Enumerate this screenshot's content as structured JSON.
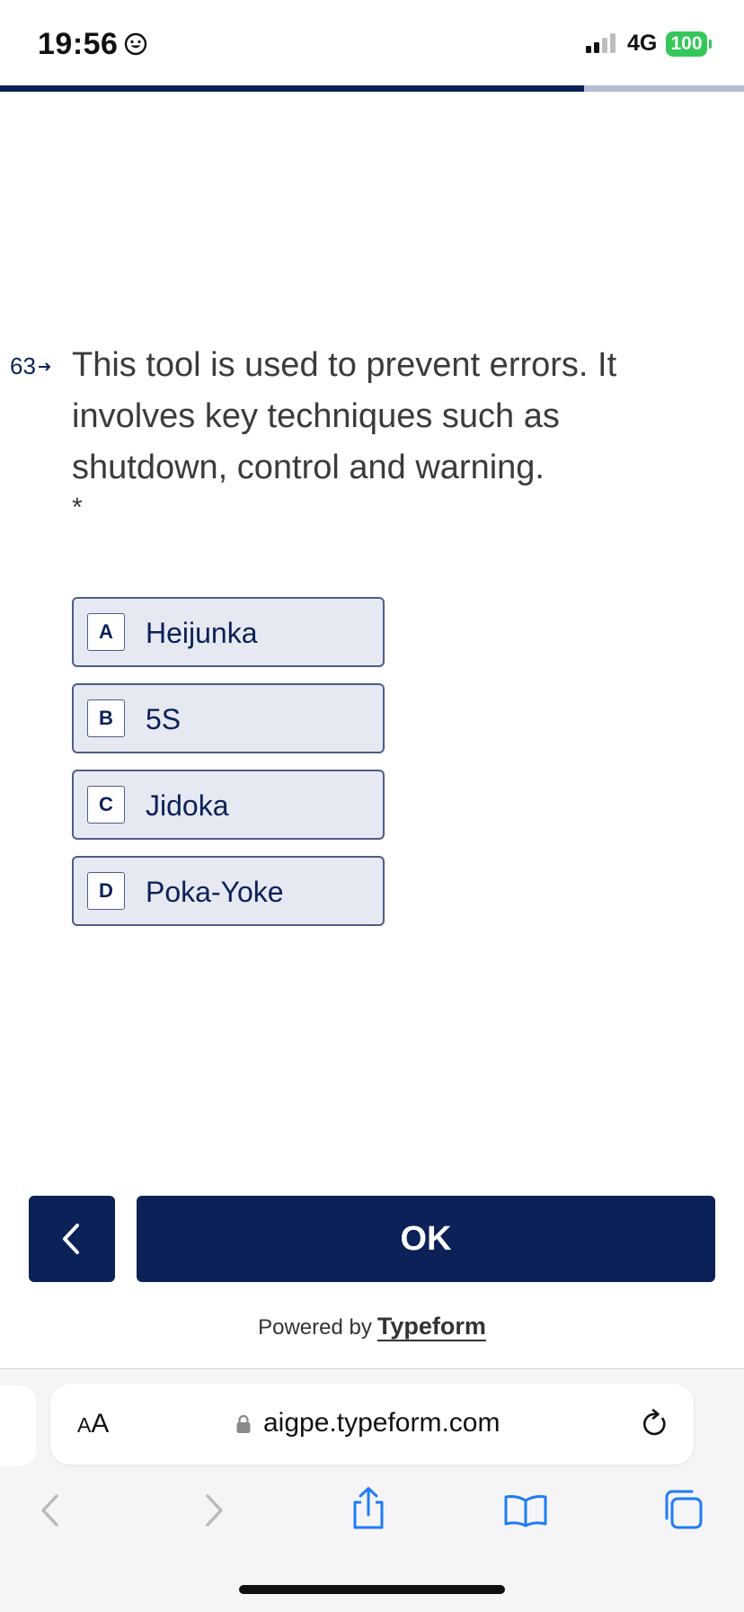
{
  "status_bar": {
    "time": "19:56",
    "network": "4G",
    "battery": "100"
  },
  "progress": {
    "fraction": 0.785
  },
  "question": {
    "number": "63",
    "text": "This tool is used to prevent errors. It involves key techniques such as shutdown, control and warning.",
    "required_marker": "*"
  },
  "options": [
    {
      "key": "A",
      "label": "Heijunka"
    },
    {
      "key": "B",
      "label": "5S"
    },
    {
      "key": "C",
      "label": "Jidoka"
    },
    {
      "key": "D",
      "label": "Poka-Yoke"
    }
  ],
  "buttons": {
    "ok_label": "OK"
  },
  "footer": {
    "powered_by": "Powered by",
    "brand": "Typeform"
  },
  "browser": {
    "text_size_label_small": "A",
    "text_size_label_large": "A",
    "url": "aigpe.typeform.com"
  },
  "colors": {
    "primary": "#0b2158",
    "option_bg": "#e6e9f2",
    "battery": "#34c759"
  }
}
